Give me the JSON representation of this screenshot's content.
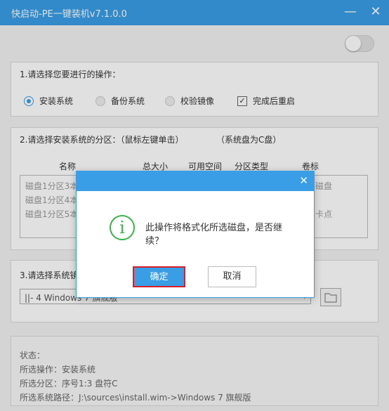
{
  "window": {
    "title": "快启动-PE一键装机v7.1.0.0",
    "min_glyph": "—",
    "close_glyph": "✕"
  },
  "step1": {
    "title": "1.请选择您要进行的操作：",
    "options": [
      "安装系统",
      "备份系统",
      "校验镜像"
    ],
    "selected": "安装系统",
    "checkbox_label": "完成后重启",
    "checkbox_checked": true
  },
  "step2": {
    "title": "2.请选择安装系统的分区：（鼠标左键单击）",
    "note": "（系统盘为C盘）",
    "columns": [
      "名称",
      "总大小",
      "可用空间",
      "分区类型",
      "卷标"
    ],
    "rows": [
      {
        "name": "磁盘1分区3本",
        "label": "磁盘"
      },
      {
        "name": "磁盘1分区4本",
        "label": ""
      },
      {
        "name": "磁盘1分区5本",
        "label": "卡点"
      }
    ]
  },
  "step3": {
    "title": "3.请选择系统镜",
    "selected_image": "||- 4 Windows  7 旗舰版"
  },
  "status": {
    "header": "状态：",
    "operation": "所选操作：安装系统",
    "partition": "所选分区：序号1:3    盘符C",
    "path": "所选系统路径：J:\\sources\\install.wim->Windows  7 旗舰版"
  },
  "dialog": {
    "message": "此操作将格式化所选磁盘，是否继续？",
    "ok_label": "确定",
    "cancel_label": "取消",
    "close_glyph": "✕",
    "info_glyph": "i"
  },
  "colors": {
    "accent": "#3a9ee6",
    "info_green": "#37b34a",
    "highlight_red": "#d9202a"
  }
}
